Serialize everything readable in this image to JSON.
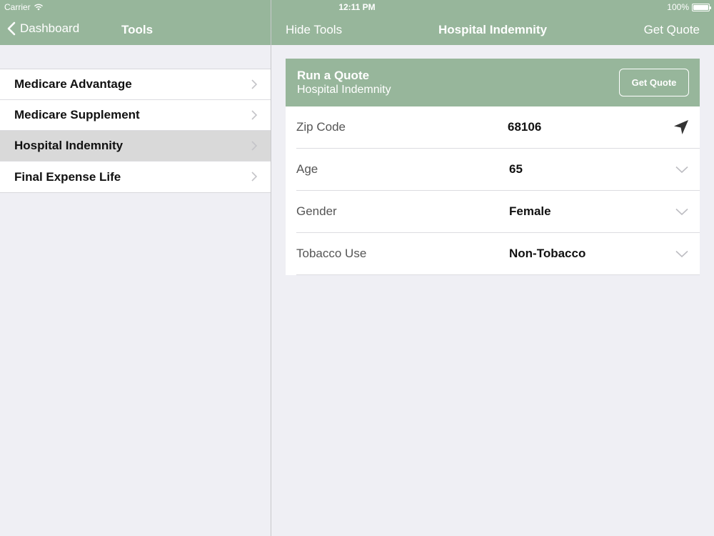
{
  "status": {
    "carrier": "Carrier",
    "time": "12:11 PM",
    "battery": "100%"
  },
  "nav": {
    "back_label": "Dashboard",
    "left_title": "Tools",
    "hide_label": "Hide Tools",
    "center_title": "Hospital Indemnity",
    "right_action": "Get Quote"
  },
  "sidebar": {
    "items": [
      {
        "label": "Medicare Advantage",
        "active": false
      },
      {
        "label": "Medicare Supplement",
        "active": false
      },
      {
        "label": "Hospital Indemnity",
        "active": true
      },
      {
        "label": "Final Expense Life",
        "active": false
      }
    ]
  },
  "quote": {
    "title": "Run a Quote",
    "subtitle": "Hospital Indemnity",
    "button": "Get Quote",
    "fields": [
      {
        "label": "Zip Code",
        "value": "68106",
        "control": "location-arrow-icon"
      },
      {
        "label": "Age",
        "value": "65",
        "control": "chevron-down-icon"
      },
      {
        "label": "Gender",
        "value": "Female",
        "control": "chevron-down-icon"
      },
      {
        "label": "Tobacco Use",
        "value": "Non-Tobacco",
        "control": "chevron-down-icon"
      }
    ]
  },
  "colors": {
    "accent": "#97b69b",
    "background": "#efeff4",
    "selected_row": "#d9d9d9"
  }
}
